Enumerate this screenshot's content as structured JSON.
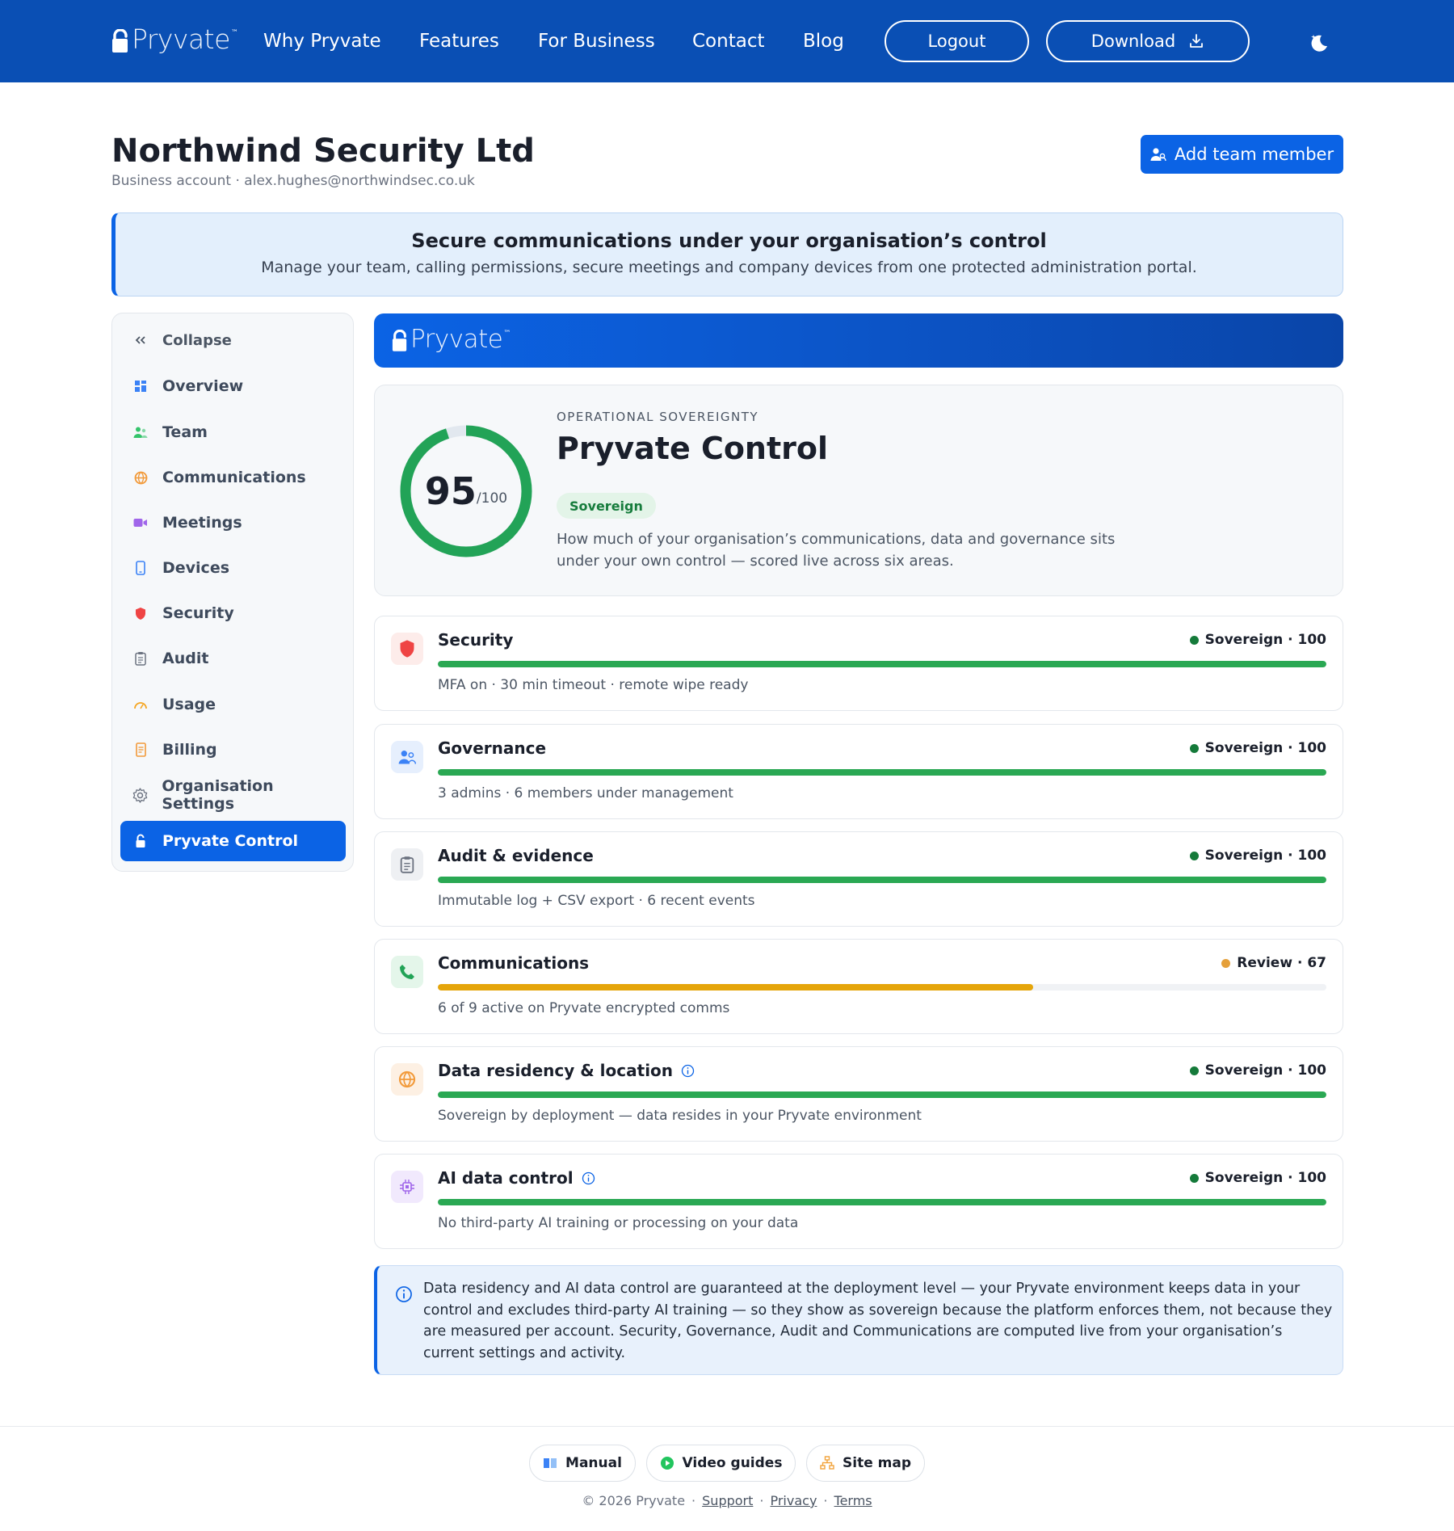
{
  "nav": {
    "logo": "Pryvate",
    "logo_tm": "™",
    "links": [
      "Why Pryvate",
      "Features",
      "For Business",
      "Contact",
      "Blog"
    ],
    "logout_label": "Logout",
    "download_label": "Download",
    "theme_icon": "moon-icon"
  },
  "header": {
    "org_name": "Northwind Security Ltd",
    "subtitle": "Business account · alex.hughes@northwindsec.co.uk",
    "add_member_label": "Add team member"
  },
  "banner": {
    "title": "Secure communications under your organisation’s control",
    "text": "Manage your team, calling permissions, secure meetings and company devices from one protected administration portal."
  },
  "sidebar": {
    "collapse_label": "Collapse",
    "items": [
      {
        "label": "Overview",
        "icon": "grid-icon"
      },
      {
        "label": "Team",
        "icon": "people-icon"
      },
      {
        "label": "Communications",
        "icon": "globe-icon"
      },
      {
        "label": "Meetings",
        "icon": "video-icon"
      },
      {
        "label": "Devices",
        "icon": "phone-icon"
      },
      {
        "label": "Security",
        "icon": "shield-icon"
      },
      {
        "label": "Audit",
        "icon": "clipboard-icon"
      },
      {
        "label": "Usage",
        "icon": "gauge-icon"
      },
      {
        "label": "Billing",
        "icon": "receipt-icon"
      },
      {
        "label": "Organisation Settings",
        "icon": "gear-icon"
      },
      {
        "label": "Pryvate Control",
        "icon": "lock-icon",
        "active": true
      }
    ]
  },
  "main": {
    "brand": "Pryvate",
    "score": {
      "value": "95",
      "max": "/100",
      "percent": 95,
      "eyebrow": "OPERATIONAL SOVEREIGNTY",
      "title": "Pryvate Control",
      "tag": "Sovereign",
      "description": "How much of your organisation’s communications, data and governance sits under your own control — scored live across six areas."
    },
    "metrics": [
      {
        "name": "Security",
        "status": "Sovereign · 100",
        "value": 100,
        "desc": "MFA on · 30 min timeout · remote wipe ready",
        "icon": "shield-icon",
        "color": "#2aa853",
        "info": false
      },
      {
        "name": "Governance",
        "status": "Sovereign · 100",
        "value": 100,
        "desc": "3 admins · 6 members under management",
        "icon": "people-icon",
        "color": "#2aa853",
        "info": false
      },
      {
        "name": "Audit & evidence",
        "status": "Sovereign · 100",
        "value": 100,
        "desc": "Immutable log + CSV export · 6 recent events",
        "icon": "clipboard-icon",
        "color": "#2aa853",
        "info": false
      },
      {
        "name": "Communications",
        "status": "Review · 67",
        "value": 67,
        "desc": "6 of 9 active on Pryvate encrypted comms",
        "icon": "phone-call-icon",
        "color": "#e5a50a",
        "info": false
      },
      {
        "name": "Data residency & location",
        "status": "Sovereign · 100",
        "value": 100,
        "desc": "Sovereign by deployment — data resides in your Pryvate environment",
        "icon": "globe-icon",
        "color": "#2aa853",
        "info": true
      },
      {
        "name": "AI data control",
        "status": "Sovereign · 100",
        "value": 100,
        "desc": "No third-party AI training or processing on your data",
        "icon": "chip-icon",
        "color": "#2aa853",
        "info": true
      }
    ],
    "note": "Data residency and AI data control are guaranteed at the deployment level — your Pryvate environment keeps data in your control and excludes third-party AI training — so they show as sovereign because the platform enforces them, not because they are measured per account. Security, Governance, Audit and Communications are computed live from your organisation’s current settings and activity."
  },
  "footer": {
    "manual_label": "Manual",
    "video_label": "Video guides",
    "sitemap_label": "Site map",
    "copyright": "© 2026 Pryvate",
    "support": "Support",
    "privacy": "Privacy",
    "terms": "Terms"
  },
  "colors": {
    "brand_blue": "#0a4fb4",
    "accent_blue": "#0b63e5",
    "sovereign_green": "#2aa853",
    "review_amber": "#e5a50a"
  }
}
